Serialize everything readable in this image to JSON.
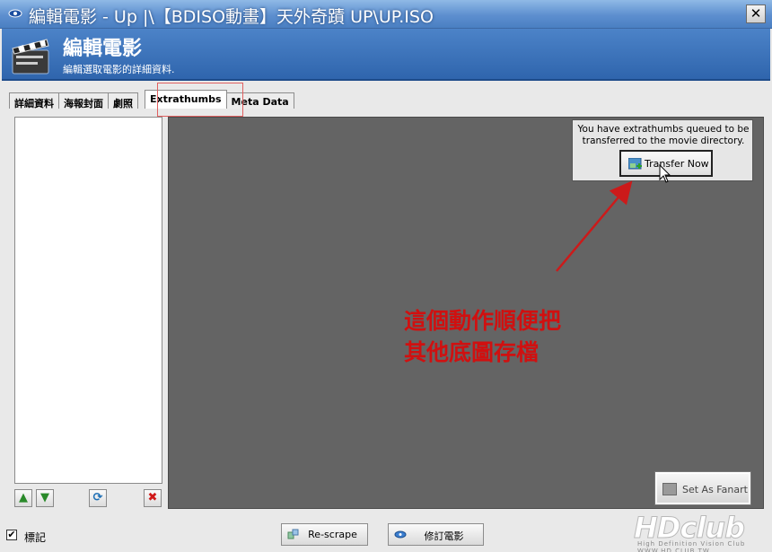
{
  "window": {
    "title": "編輯電影 - Up |\\【BDISO動畫】天外奇蹟 UP\\UP.ISO",
    "close_glyph": "✕"
  },
  "header": {
    "title": "編輯電影",
    "subtitle": "編輯選取電影的詳細資料."
  },
  "tabs": [
    {
      "label": "詳細資料",
      "active": false
    },
    {
      "label": "海報封面",
      "active": false
    },
    {
      "label": "劇照",
      "active": false
    },
    {
      "label": "Extrathumbs",
      "active": true
    },
    {
      "label": "Meta Data",
      "active": false
    }
  ],
  "list_buttons": {
    "up_glyph": "▲",
    "down_glyph": "▼",
    "refresh_glyph": "⟳",
    "delete_glyph": "✖"
  },
  "notification": {
    "message": "You have extrathumbs queued to be transferred to the movie directory.",
    "button_label": "Transfer Now"
  },
  "annotation": {
    "line1": "這個動作順便把",
    "line2": "其他底圖存檔"
  },
  "fanart_button": {
    "label": "Set As Fanart"
  },
  "footer": {
    "checkbox_label": "標記",
    "checkbox_checked": true,
    "checkbox_glyph": "✔",
    "rescrape_label": "Re-scrape",
    "save_label": "修訂電影"
  },
  "watermark": {
    "main": "HDclub",
    "sub": "High Definition Vision Club   WWW.HD.CLUB.TW"
  },
  "colors": {
    "titlebar": "#5d8fcf",
    "header": "#3a70b8",
    "main_pane": "#646464",
    "annotation": "#d01010"
  }
}
